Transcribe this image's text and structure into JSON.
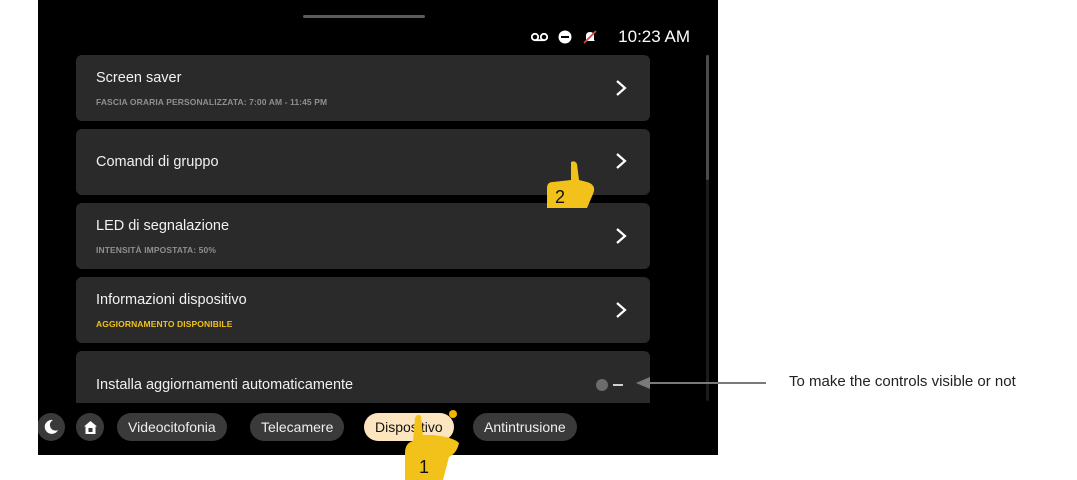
{
  "status_bar": {
    "time": "10:23 AM",
    "icons": [
      "voicemail-icon",
      "do-not-disturb-icon",
      "mute-bell-icon"
    ]
  },
  "settings": [
    {
      "title": "Screen saver",
      "subtitle": "FASCIA ORARIA PERSONALIZZATA: 7:00 AM - 11:45 PM",
      "subtitle_accent": false
    },
    {
      "title": "Comandi di gruppo",
      "subtitle": "",
      "subtitle_accent": false
    },
    {
      "title": "LED di segnalazione",
      "subtitle": "INTENSITÀ IMPOSTATA: 50%",
      "subtitle_accent": false
    },
    {
      "title": "Informazioni dispositivo",
      "subtitle": "AGGIORNAMENTO DISPONIBILE",
      "subtitle_accent": true
    },
    {
      "title": "Installa aggiornamenti automaticamente",
      "toggle": "off"
    }
  ],
  "nav": {
    "night_mode_icon": "moon-icon",
    "home_icon": "home-icon",
    "tabs": [
      "Videocitofonia",
      "Telecamere",
      "Dispositivo",
      "Antintrusione"
    ],
    "active_tab": "Dispositivo"
  },
  "annotations": {
    "step1": "1",
    "step2": "2",
    "callout": "To make the controls visible or not"
  },
  "colors": {
    "accent": "#f1c01d",
    "active_tab_bg": "#fde6bf",
    "card_bg": "#2a2a2a",
    "screen_bg": "#000000"
  }
}
